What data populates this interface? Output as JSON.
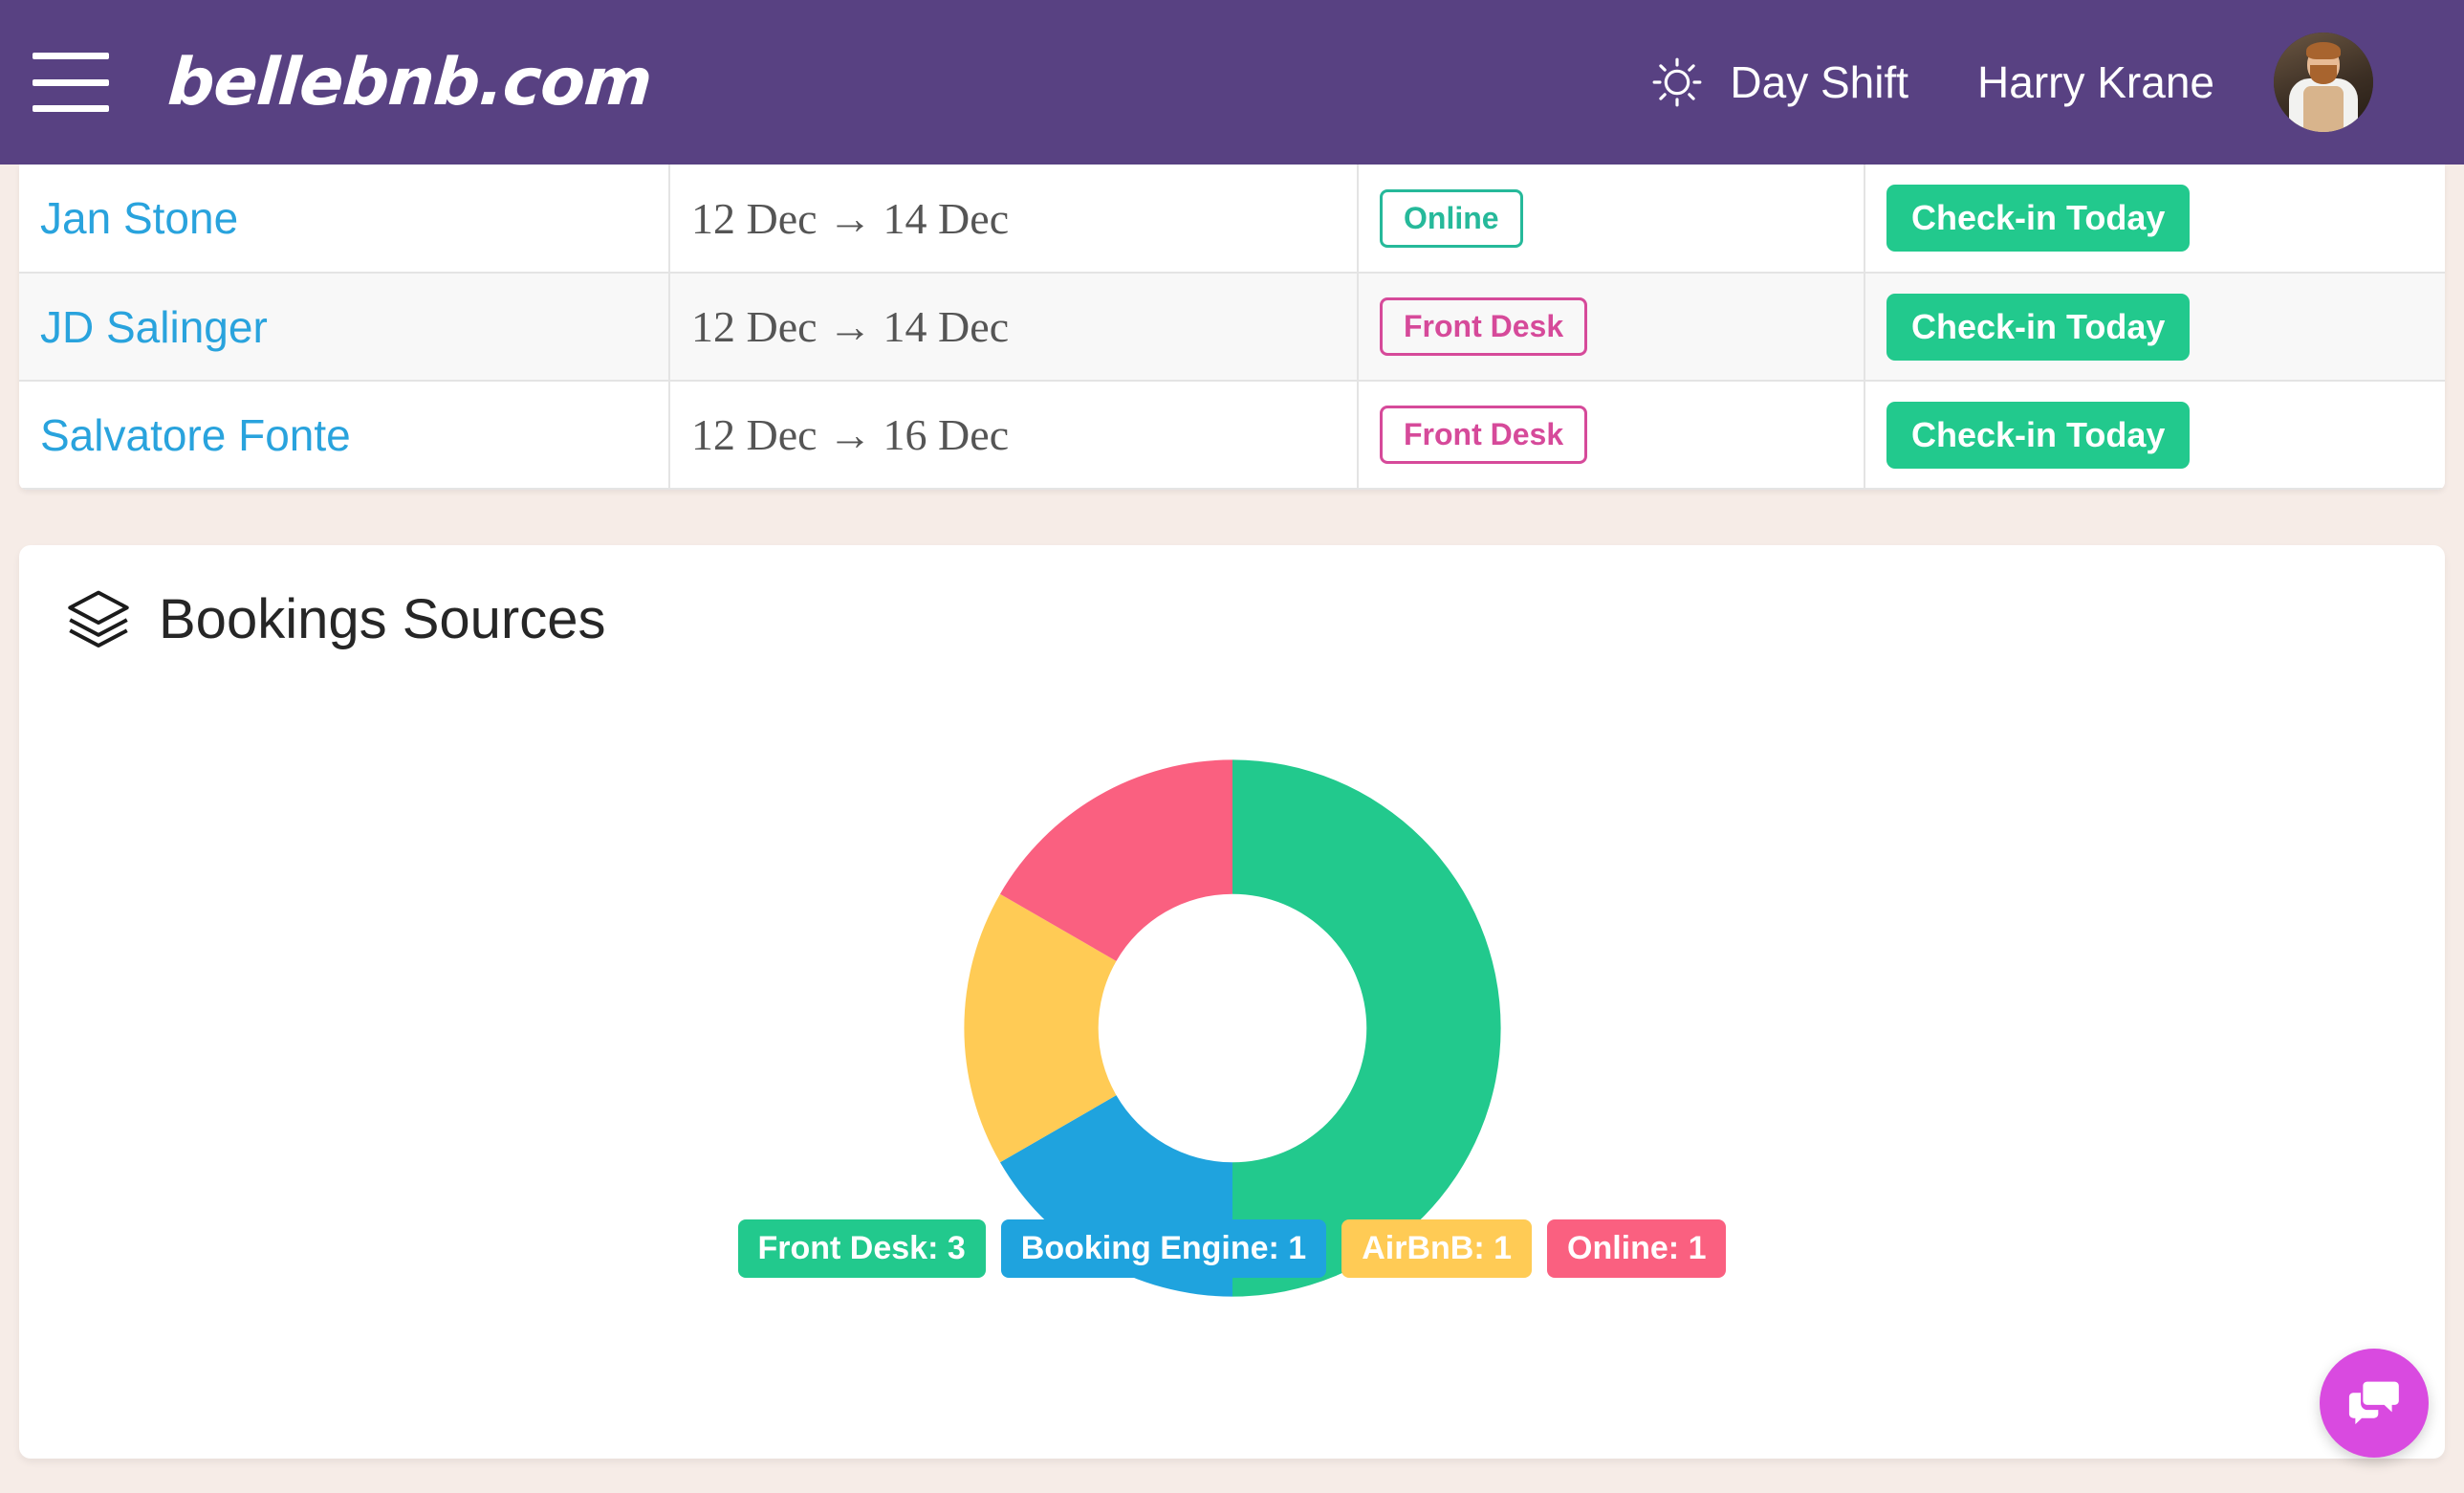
{
  "header": {
    "menu_icon": "hamburger-icon",
    "brand": "bellebnb.com",
    "shift_icon": "sun-icon",
    "shift_label": "Day Shift",
    "user_name": "Harry Krane",
    "avatar_icon": "user-avatar",
    "background_color": "#584182"
  },
  "bookings_table": {
    "rows": [
      {
        "guest": "Jan Stone",
        "dates": "12 Dec → 14 Dec",
        "source": "Online",
        "source_style": "teal",
        "action": "Check-in Today"
      },
      {
        "guest": "JD Salinger",
        "dates": "12 Dec → 14 Dec",
        "source": "Front Desk",
        "source_style": "pink",
        "action": "Check-in Today"
      },
      {
        "guest": "Salvatore Fonte",
        "dates": "12 Dec → 16 Dec",
        "source": "Front Desk",
        "source_style": "pink",
        "action": "Check-in Today"
      }
    ]
  },
  "bookings_sources_card": {
    "icon": "layers-icon",
    "title": "Bookings Sources"
  },
  "chart_data": {
    "type": "pie",
    "title": "Bookings Sources",
    "donut": true,
    "inner_radius_ratio": 0.54,
    "total": 6,
    "start_angle_deg": 0,
    "direction": "clockwise",
    "legend_position": "bottom",
    "categories": [
      "Front Desk",
      "Booking Engine",
      "AirBnB",
      "Online"
    ],
    "values": [
      3,
      1,
      1,
      1
    ],
    "colors": [
      "#22c98d",
      "#1fa3de",
      "#ffcb55",
      "#fa6080"
    ],
    "legend_labels": [
      "Front Desk: 3",
      "Booking Engine: 1",
      "AirBnB: 1",
      "Online: 1"
    ],
    "slice_angles_deg": [
      180,
      60,
      60,
      60
    ],
    "percentages": [
      50,
      16.7,
      16.7,
      16.7
    ]
  },
  "chat_widget": {
    "icon": "chat-bubbles-icon",
    "color": "#d94ae0"
  }
}
